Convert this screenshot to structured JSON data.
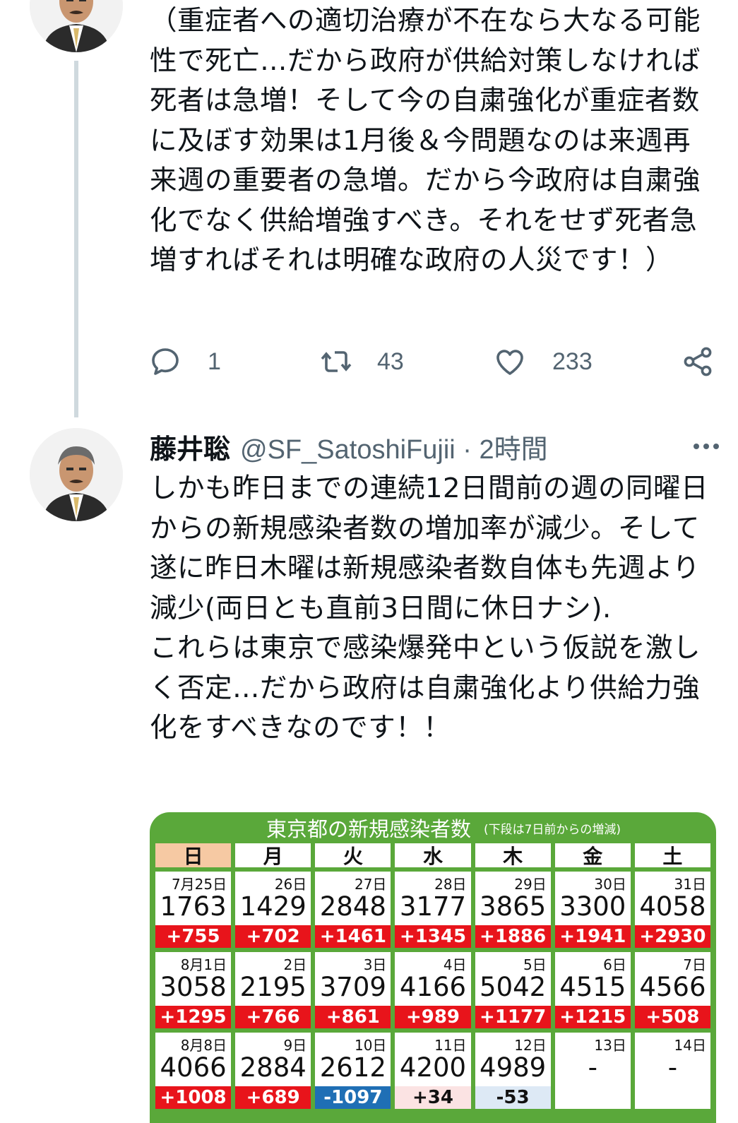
{
  "prev_tweet": {
    "text": "（重症者への適切治療が不在なら大なる可能性で死亡…だから政府が供給対策しなければ死者は急増！そして今の自粛強化が重症者数に及ぼす効果は1月後＆今問題なのは来週再来週の重要者の急増。だから今政府は自粛強化でなく供給増強すべき。それをせず死者急増すればそれは明確な政府の人災です！）",
    "reply_count": "1",
    "retweet_count": "43",
    "like_count": "233"
  },
  "tweet": {
    "author_name": "藤井聡",
    "handle_time": "@SF_SatoshiFujii · 2時間",
    "text": "しかも昨日までの連続12日間前の週の同曜日からの新規感染者数の増加率が減少。そして遂に昨日木曜は新規感染者数自体も先週より減少(両日とも直前3日間に休日ナシ).\nこれらは東京で感染爆発中という仮説を激しく否定…だから政府は自粛強化より供給力強化をすべきなのです！！"
  },
  "media": {
    "title": "東京都の新規感染者数",
    "subtitle": "(下段は7日前からの増減)",
    "weekdays": [
      "日",
      "月",
      "火",
      "水",
      "木",
      "金",
      "土"
    ],
    "weeks": [
      [
        {
          "date": "7月25日",
          "value": "1763",
          "change": "+755",
          "style": "red"
        },
        {
          "date": "26日",
          "value": "1429",
          "change": "+702",
          "style": "red"
        },
        {
          "date": "27日",
          "value": "2848",
          "change": "+1461",
          "style": "red"
        },
        {
          "date": "28日",
          "value": "3177",
          "change": "+1345",
          "style": "red"
        },
        {
          "date": "29日",
          "value": "3865",
          "change": "+1886",
          "style": "red"
        },
        {
          "date": "30日",
          "value": "3300",
          "change": "+1941",
          "style": "red"
        },
        {
          "date": "31日",
          "value": "4058",
          "change": "+2930",
          "style": "red"
        }
      ],
      [
        {
          "date": "8月1日",
          "value": "3058",
          "change": "+1295",
          "style": "red"
        },
        {
          "date": "2日",
          "value": "2195",
          "change": "+766",
          "style": "red"
        },
        {
          "date": "3日",
          "value": "3709",
          "change": "+861",
          "style": "red"
        },
        {
          "date": "4日",
          "value": "4166",
          "change": "+989",
          "style": "red"
        },
        {
          "date": "5日",
          "value": "5042",
          "change": "+1177",
          "style": "red"
        },
        {
          "date": "6日",
          "value": "4515",
          "change": "+1215",
          "style": "red"
        },
        {
          "date": "7日",
          "value": "4566",
          "change": "+508",
          "style": "red"
        }
      ],
      [
        {
          "date": "8月8日",
          "value": "4066",
          "change": "+1008",
          "style": "red"
        },
        {
          "date": "9日",
          "value": "2884",
          "change": "+689",
          "style": "red"
        },
        {
          "date": "10日",
          "value": "2612",
          "change": "-1097",
          "style": "blue"
        },
        {
          "date": "11日",
          "value": "4200",
          "change": "+34",
          "style": "pink"
        },
        {
          "date": "12日",
          "value": "4989",
          "change": "-53",
          "style": "lightblue"
        },
        {
          "date": "13日",
          "value": "-",
          "change": "",
          "style": "none"
        },
        {
          "date": "14日",
          "value": "-",
          "change": "",
          "style": "none"
        }
      ]
    ]
  },
  "colors": {
    "text": "#0f1419",
    "secondary": "#536471",
    "thread_line": "#cfd9de",
    "table_green": "#5aa83a",
    "increase_red": "#e8141b",
    "decrease_blue": "#1f6fb5"
  },
  "icons": [
    "reply-icon",
    "retweet-icon",
    "like-icon",
    "share-icon",
    "more-icon"
  ]
}
